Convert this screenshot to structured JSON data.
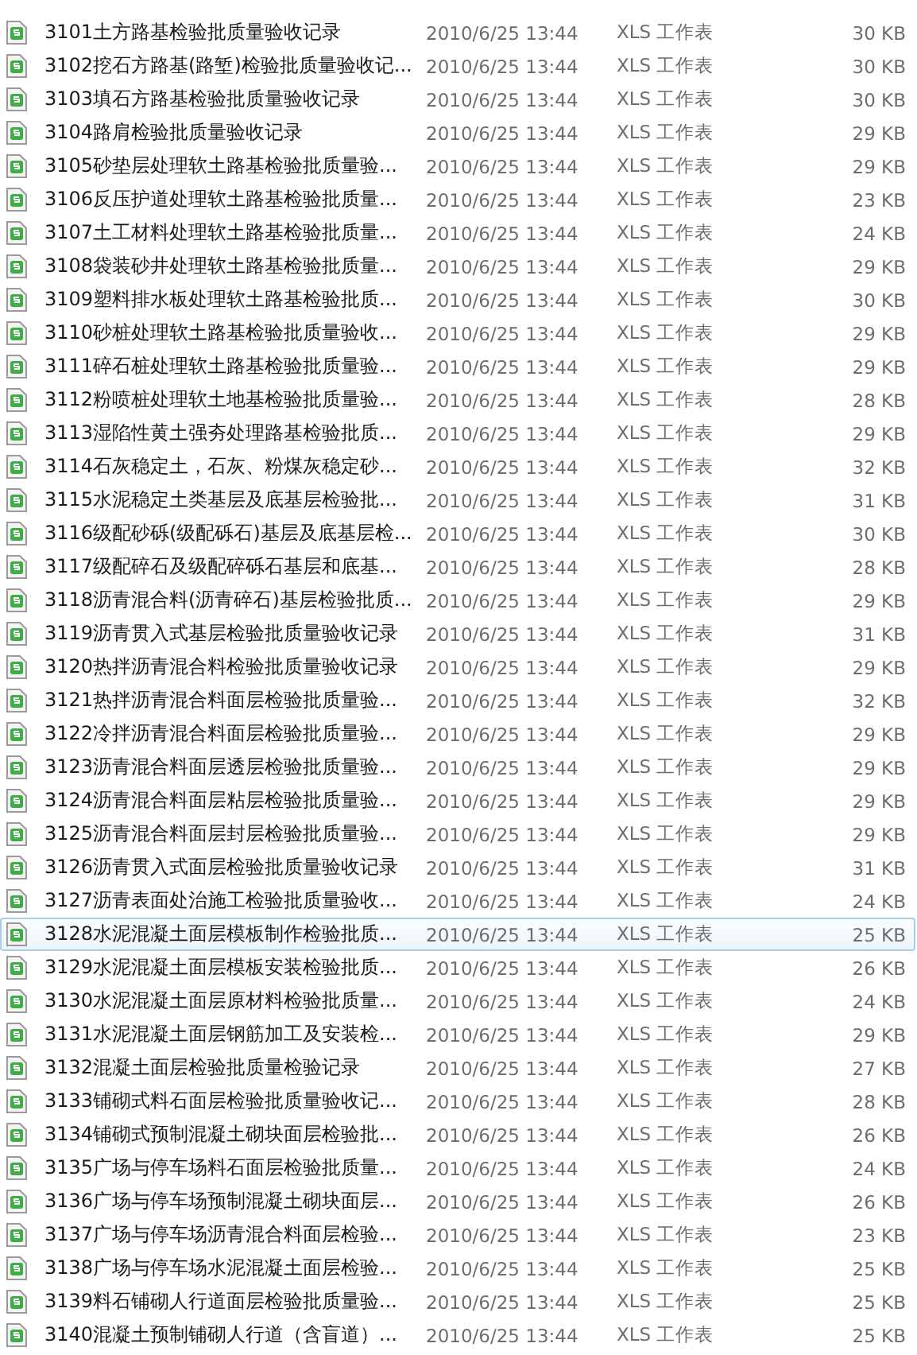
{
  "files": [
    {
      "name": "3101土方路基检验批质量验收记录",
      "modified": "2010/6/25 13:44",
      "type": "XLS 工作表",
      "size": "30 KB",
      "selected": false
    },
    {
      "name": "3102挖石方路基(路堑)检验批质量验收记...",
      "modified": "2010/6/25 13:44",
      "type": "XLS 工作表",
      "size": "30 KB",
      "selected": false
    },
    {
      "name": "3103填石方路基检验批质量验收记录",
      "modified": "2010/6/25 13:44",
      "type": "XLS 工作表",
      "size": "30 KB",
      "selected": false
    },
    {
      "name": "3104路肩检验批质量验收记录",
      "modified": "2010/6/25 13:44",
      "type": "XLS 工作表",
      "size": "29 KB",
      "selected": false
    },
    {
      "name": "3105砂垫层处理软土路基检验批质量验...",
      "modified": "2010/6/25 13:44",
      "type": "XLS 工作表",
      "size": "29 KB",
      "selected": false
    },
    {
      "name": "3106反压护道处理软土路基检验批质量...",
      "modified": "2010/6/25 13:44",
      "type": "XLS 工作表",
      "size": "23 KB",
      "selected": false
    },
    {
      "name": "3107土工材料处理软土路基检验批质量...",
      "modified": "2010/6/25 13:44",
      "type": "XLS 工作表",
      "size": "24 KB",
      "selected": false
    },
    {
      "name": "3108袋装砂井处理软土路基检验批质量...",
      "modified": "2010/6/25 13:44",
      "type": "XLS 工作表",
      "size": "29 KB",
      "selected": false
    },
    {
      "name": "3109塑料排水板处理软土路基检验批质...",
      "modified": "2010/6/25 13:44",
      "type": "XLS 工作表",
      "size": "30 KB",
      "selected": false
    },
    {
      "name": "3110砂桩处理软土路基检验批质量验收...",
      "modified": "2010/6/25 13:44",
      "type": "XLS 工作表",
      "size": "29 KB",
      "selected": false
    },
    {
      "name": "3111碎石桩处理软土路基检验批质量验...",
      "modified": "2010/6/25 13:44",
      "type": "XLS 工作表",
      "size": "29 KB",
      "selected": false
    },
    {
      "name": "3112粉喷桩处理软土地基检验批质量验...",
      "modified": "2010/6/25 13:44",
      "type": "XLS 工作表",
      "size": "28 KB",
      "selected": false
    },
    {
      "name": "3113湿陷性黄土强夯处理路基检验批质...",
      "modified": "2010/6/25 13:44",
      "type": "XLS 工作表",
      "size": "29 KB",
      "selected": false
    },
    {
      "name": "3114石灰稳定土，石灰、粉煤灰稳定砂...",
      "modified": "2010/6/25 13:44",
      "type": "XLS 工作表",
      "size": "32 KB",
      "selected": false
    },
    {
      "name": "3115水泥稳定土类基层及底基层检验批...",
      "modified": "2010/6/25 13:44",
      "type": "XLS 工作表",
      "size": "31 KB",
      "selected": false
    },
    {
      "name": "3116级配砂砾(级配砾石)基层及底基层检...",
      "modified": "2010/6/25 13:44",
      "type": "XLS 工作表",
      "size": "30 KB",
      "selected": false
    },
    {
      "name": "3117级配碎石及级配碎砾石基层和底基...",
      "modified": "2010/6/25 13:44",
      "type": "XLS 工作表",
      "size": "28 KB",
      "selected": false
    },
    {
      "name": "3118沥青混合料(沥青碎石)基层检验批质...",
      "modified": "2010/6/25 13:44",
      "type": "XLS 工作表",
      "size": "29 KB",
      "selected": false
    },
    {
      "name": "3119沥青贯入式基层检验批质量验收记录",
      "modified": "2010/6/25 13:44",
      "type": "XLS 工作表",
      "size": "31 KB",
      "selected": false
    },
    {
      "name": "3120热拌沥青混合料检验批质量验收记录",
      "modified": "2010/6/25 13:44",
      "type": "XLS 工作表",
      "size": "29 KB",
      "selected": false
    },
    {
      "name": "3121热拌沥青混合料面层检验批质量验...",
      "modified": "2010/6/25 13:44",
      "type": "XLS 工作表",
      "size": "32 KB",
      "selected": false
    },
    {
      "name": "3122冷拌沥青混合料面层检验批质量验...",
      "modified": "2010/6/25 13:44",
      "type": "XLS 工作表",
      "size": "29 KB",
      "selected": false
    },
    {
      "name": "3123沥青混合料面层透层检验批质量验...",
      "modified": "2010/6/25 13:44",
      "type": "XLS 工作表",
      "size": "29 KB",
      "selected": false
    },
    {
      "name": "3124沥青混合料面层粘层检验批质量验...",
      "modified": "2010/6/25 13:44",
      "type": "XLS 工作表",
      "size": "29 KB",
      "selected": false
    },
    {
      "name": "3125沥青混合料面层封层检验批质量验...",
      "modified": "2010/6/25 13:44",
      "type": "XLS 工作表",
      "size": "29 KB",
      "selected": false
    },
    {
      "name": "3126沥青贯入式面层检验批质量验收记录",
      "modified": "2010/6/25 13:44",
      "type": "XLS 工作表",
      "size": "31 KB",
      "selected": false
    },
    {
      "name": "3127沥青表面处治施工检验批质量验收...",
      "modified": "2010/6/25 13:44",
      "type": "XLS 工作表",
      "size": "24 KB",
      "selected": false
    },
    {
      "name": "3128水泥混凝土面层模板制作检验批质...",
      "modified": "2010/6/25 13:44",
      "type": "XLS 工作表",
      "size": "25 KB",
      "selected": true
    },
    {
      "name": "3129水泥混凝土面层模板安装检验批质...",
      "modified": "2010/6/25 13:44",
      "type": "XLS 工作表",
      "size": "26 KB",
      "selected": false
    },
    {
      "name": "3130水泥混凝土面层原材料检验批质量...",
      "modified": "2010/6/25 13:44",
      "type": "XLS 工作表",
      "size": "24 KB",
      "selected": false
    },
    {
      "name": "3131水泥混凝土面层钢筋加工及安装检...",
      "modified": "2010/6/25 13:44",
      "type": "XLS 工作表",
      "size": "29 KB",
      "selected": false
    },
    {
      "name": "3132混凝土面层检验批质量检验记录",
      "modified": "2010/6/25 13:44",
      "type": "XLS 工作表",
      "size": "27 KB",
      "selected": false
    },
    {
      "name": "3133铺砌式料石面层检验批质量验收记...",
      "modified": "2010/6/25 13:44",
      "type": "XLS 工作表",
      "size": "28 KB",
      "selected": false
    },
    {
      "name": "3134铺砌式预制混凝土砌块面层检验批...",
      "modified": "2010/6/25 13:44",
      "type": "XLS 工作表",
      "size": "26 KB",
      "selected": false
    },
    {
      "name": "3135广场与停车场料石面层检验批质量...",
      "modified": "2010/6/25 13:44",
      "type": "XLS 工作表",
      "size": "24 KB",
      "selected": false
    },
    {
      "name": "3136广场与停车场预制混凝土砌块面层...",
      "modified": "2010/6/25 13:44",
      "type": "XLS 工作表",
      "size": "26 KB",
      "selected": false
    },
    {
      "name": "3137广场与停车场沥青混合料面层检验...",
      "modified": "2010/6/25 13:44",
      "type": "XLS 工作表",
      "size": "23 KB",
      "selected": false
    },
    {
      "name": "3138广场与停车场水泥混凝土面层检验...",
      "modified": "2010/6/25 13:44",
      "type": "XLS 工作表",
      "size": "25 KB",
      "selected": false
    },
    {
      "name": "3139料石铺砌人行道面层检验批质量验...",
      "modified": "2010/6/25 13:44",
      "type": "XLS 工作表",
      "size": "25 KB",
      "selected": false
    },
    {
      "name": "3140混凝土预制铺砌人行道（含盲道）...",
      "modified": "2010/6/25 13:44",
      "type": "XLS 工作表",
      "size": "25 KB",
      "selected": false
    }
  ]
}
